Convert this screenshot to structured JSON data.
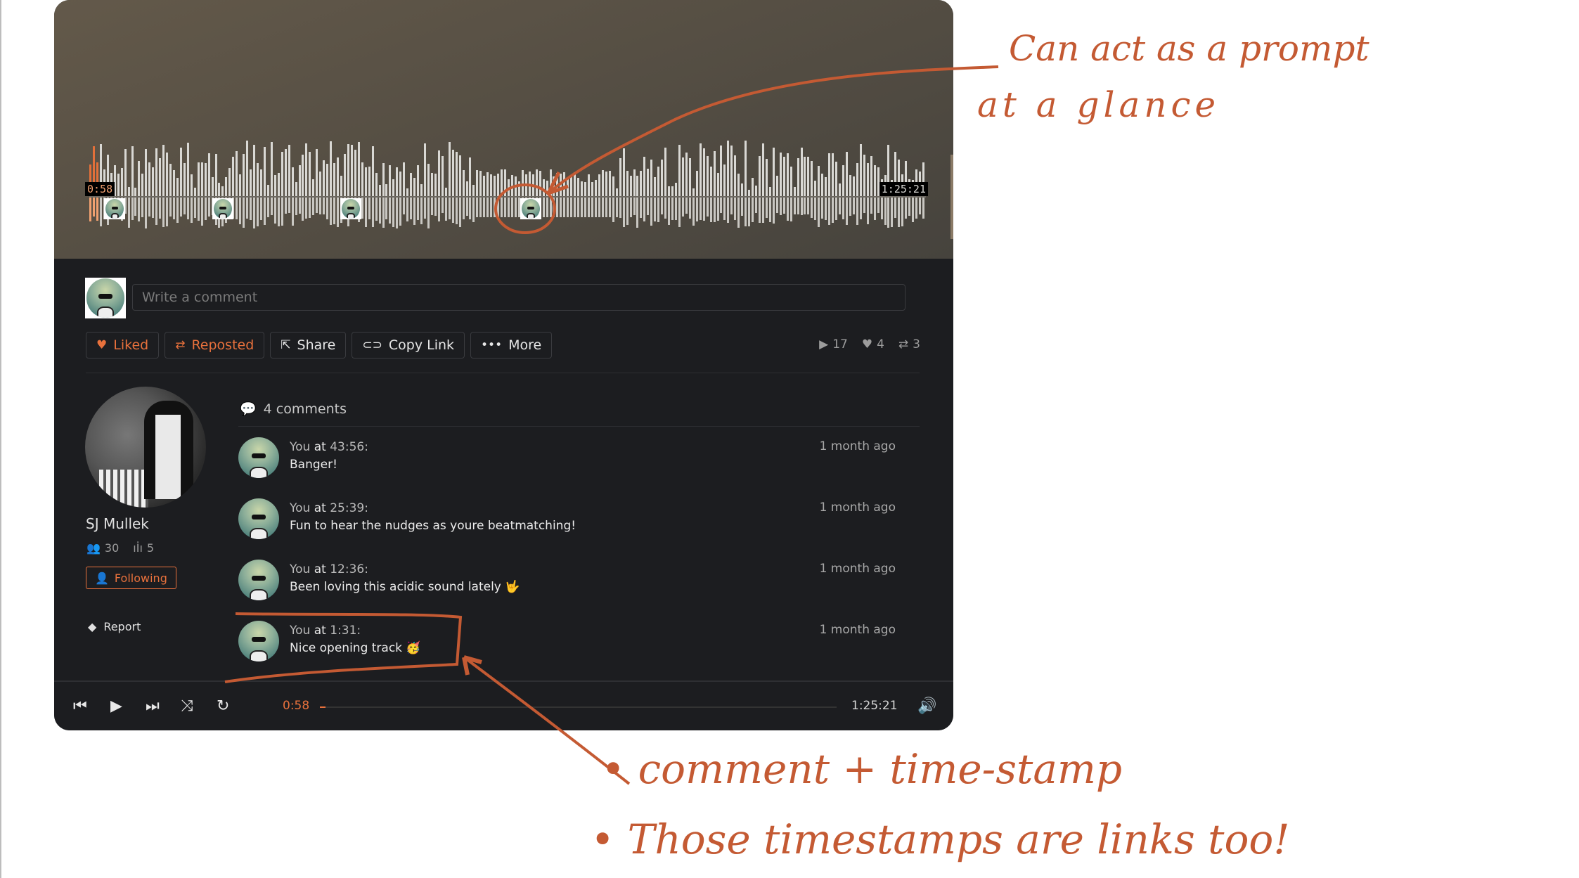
{
  "colors": {
    "accent": "#e8713c",
    "annotation": "#c45a33",
    "panel_bg": "#1c1d20"
  },
  "waveform": {
    "current_time": "0:58",
    "total_time": "1:25:21",
    "played_fraction": 0.011,
    "comment_markers": [
      {
        "label": "comment-marker-1:31",
        "position_fraction": 0.018
      },
      {
        "label": "comment-marker-12:36",
        "position_fraction": 0.147
      },
      {
        "label": "comment-marker-25:39",
        "position_fraction": 0.3
      },
      {
        "label": "comment-marker-43:56",
        "position_fraction": 0.515
      }
    ]
  },
  "comment_box": {
    "placeholder": "Write a comment"
  },
  "actions": {
    "liked": "Liked",
    "reposted": "Reposted",
    "share": "Share",
    "copy_link": "Copy Link",
    "more": "More"
  },
  "stats": {
    "plays": "17",
    "likes": "4",
    "reposts": "3"
  },
  "artist": {
    "name": "SJ Mullek",
    "followers": "30",
    "tracks": "5",
    "follow_label": "Following",
    "report_label": "Report"
  },
  "comments": {
    "count_label": "4 comments",
    "items": [
      {
        "user": "You",
        "at": "at",
        "timestamp": "43:56:",
        "text": "Banger!",
        "ago": "1 month ago"
      },
      {
        "user": "You",
        "at": "at",
        "timestamp": "25:39:",
        "text": "Fun to hear the nudges as youre beatmatching!",
        "ago": "1 month ago"
      },
      {
        "user": "You",
        "at": "at",
        "timestamp": "12:36:",
        "text": "Been loving this acidic sound lately 🤟",
        "ago": "1 month ago"
      },
      {
        "user": "You",
        "at": "at",
        "timestamp": "1:31:",
        "text": "Nice opening track 🥳",
        "ago": "1 month ago"
      }
    ]
  },
  "player": {
    "current_time": "0:58",
    "total_time": "1:25:21",
    "progress_fraction": 0.011
  },
  "annotations": {
    "top_line1": "Can act as a prompt",
    "top_line2": "at a glance",
    "bottom_line1": "• comment + time-stamp",
    "bottom_line2": "• Those timestamps are links too!"
  }
}
